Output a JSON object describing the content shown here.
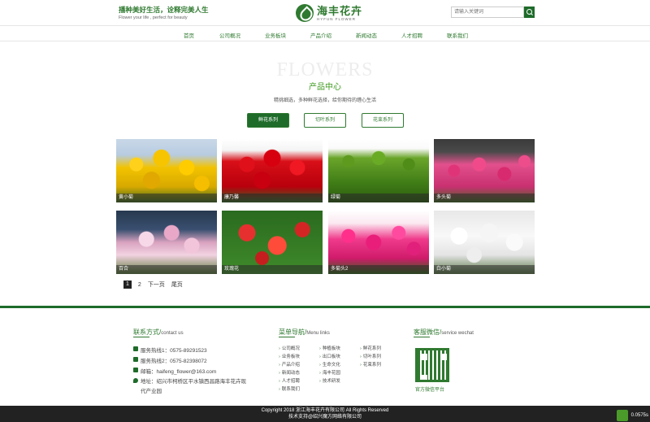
{
  "header": {
    "slogan_cn": "播种美好生活，诠释完美人生",
    "slogan_en": "Flower your life ,  perfect for beauty",
    "logo_cn": "海丰花卉",
    "logo_en": "HYFUN FLOWER",
    "search_placeholder": "请输入关键词"
  },
  "nav": {
    "items": [
      "首页",
      "公司概况",
      "业务板块",
      "产品介绍",
      "新闻动态",
      "人才招聘",
      "联系我们"
    ]
  },
  "section": {
    "bg_title": "FLOWERS",
    "title": "产品中心",
    "subtitle": "精挑细选，多种鲜花选择，给你期待的缠心生活"
  },
  "tabs": [
    {
      "label": "鲜花系列",
      "active": true
    },
    {
      "label": "切叶系列",
      "active": false
    },
    {
      "label": "花束系列",
      "active": false
    }
  ],
  "products": [
    {
      "name": "黄小菊"
    },
    {
      "name": "康乃馨"
    },
    {
      "name": "绿菊"
    },
    {
      "name": "多头菊"
    },
    {
      "name": "百合"
    },
    {
      "name": "玫瑰花"
    },
    {
      "name": "多菊头2"
    },
    {
      "name": "白小菊"
    }
  ],
  "pager": {
    "current": "1",
    "page2": "2",
    "next": "下一页",
    "last": "尾页"
  },
  "footer": {
    "contact_title": "联系方式/",
    "contact_title_en": "contact us",
    "hotline1": "服务热线1：0575-89291523",
    "hotline2": "服务热线2：0575-82398072",
    "email": "邮箱：haifeng_flower@163.com",
    "address": "地址：绍兴市柯桥区平水镇西昌路海丰花卉现代产业园",
    "menu_title": "菜单导航/",
    "menu_title_en": "Menu links",
    "menu_col1": [
      "公司概况",
      "业务板块",
      "产品介绍",
      "新闻动态",
      "人才招聘",
      "联系我们"
    ],
    "menu_col2": [
      "种植板块",
      "出口板块",
      "生命文化",
      "海丰花园",
      "技术研发"
    ],
    "menu_col3": [
      "鲜花系列",
      "切叶系列",
      "花束系列"
    ],
    "wechat_title": "客服微信/",
    "wechat_title_en": "service wechat",
    "wechat_caption": "官方微信平台"
  },
  "bottom": {
    "copyright": "Copyright 2018 浙江海丰花卉有限公司 All Rights Reserved",
    "support": "技术支持@绍兴魔方网络有限公司",
    "perf": "0.0575s"
  }
}
